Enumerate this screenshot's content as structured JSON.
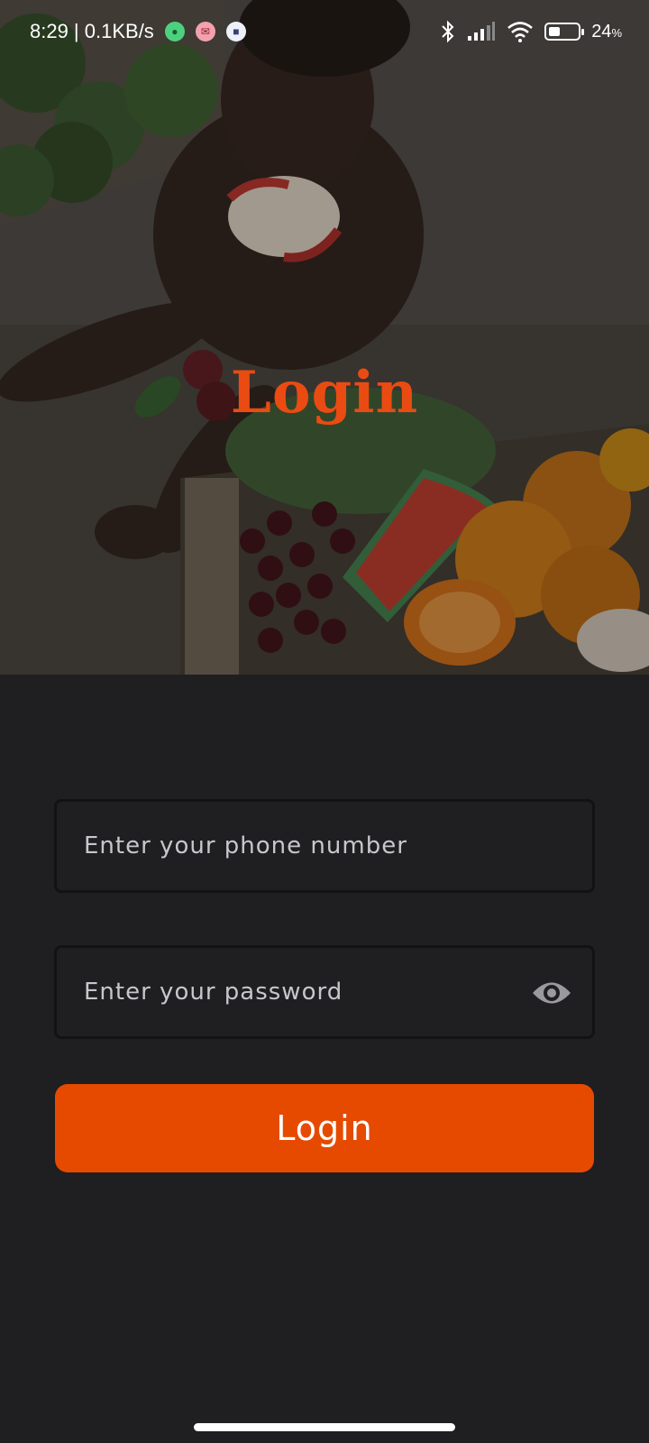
{
  "status_bar": {
    "time_and_speed": "8:29 | 0.1KB/s",
    "battery_percent": "24",
    "battery_unit": "%",
    "battery_level": 0.24,
    "notification_icons": [
      "chat-app-icon",
      "mail-app-icon",
      "lock-app-icon"
    ]
  },
  "hero": {
    "title": "Login",
    "background_image": "baby-with-fruits-photo"
  },
  "form": {
    "phone": {
      "placeholder": "Enter your phone number",
      "value": ""
    },
    "password": {
      "placeholder": "Enter your password",
      "value": ""
    },
    "login_label": "Login"
  },
  "colors": {
    "accent": "#e64a00",
    "title": "#ea4b12",
    "background": "#1f1e20",
    "field_border": "#121113"
  }
}
